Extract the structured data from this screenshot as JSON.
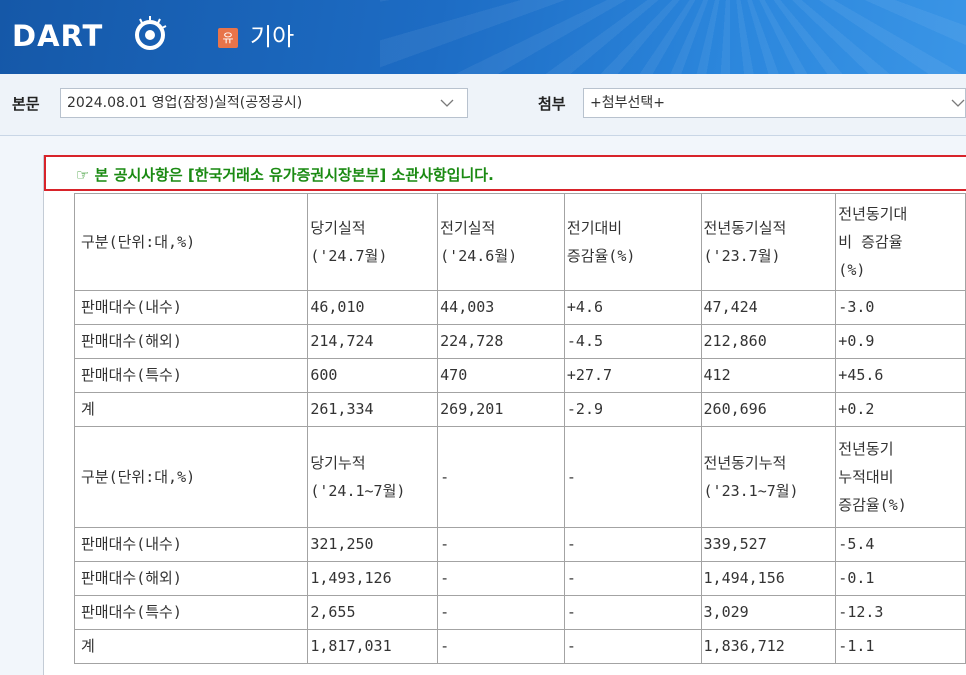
{
  "header": {
    "logo_text": "DART",
    "market_badge": "유",
    "company": "기아"
  },
  "subbar": {
    "body_label": "본문",
    "body_select": "2024.08.01  영업(잠정)실적(공정공시)",
    "attach_label": "첨부",
    "attach_select": "+첨부선택+"
  },
  "notice": "☞ 본 공시사항은 [한국거래소 유가증권시장본부] 소관사항입니다.",
  "table": {
    "monthly_header": {
      "c0": "구분(단위:대,%)",
      "c1": [
        "당기실적",
        "('24.7월)"
      ],
      "c2": [
        "전기실적",
        "('24.6월)"
      ],
      "c3": [
        "전기대비",
        "증감율(%)"
      ],
      "c4": [
        "전년동기실적",
        "('23.7월)"
      ],
      "c5": [
        "전년동기대",
        "비 증감율",
        "(%)"
      ]
    },
    "monthly_rows": [
      [
        "판매대수(내수)",
        "46,010",
        "44,003",
        "+4.6",
        "47,424",
        "-3.0"
      ],
      [
        "판매대수(해외)",
        "214,724",
        "224,728",
        "-4.5",
        "212,860",
        "+0.9"
      ],
      [
        "판매대수(특수)",
        "600",
        "470",
        "+27.7",
        "412",
        "+45.6"
      ],
      [
        "계",
        "261,334",
        "269,201",
        "-2.9",
        "260,696",
        "+0.2"
      ]
    ],
    "cumulative_header": {
      "c0": "구분(단위:대,%)",
      "c1": [
        "당기누적",
        "('24.1~7월)"
      ],
      "c2": "-",
      "c3": "-",
      "c4": [
        "전년동기누적",
        "('23.1~7월)"
      ],
      "c5": [
        "전년동기",
        "누적대비",
        "증감율(%)"
      ]
    },
    "cumulative_rows": [
      [
        "판매대수(내수)",
        "321,250",
        "-",
        "-",
        "339,527",
        "-5.4"
      ],
      [
        "판매대수(해외)",
        "1,493,126",
        "-",
        "-",
        "1,494,156",
        "-0.1"
      ],
      [
        "판매대수(특수)",
        "2,655",
        "-",
        "-",
        "3,029",
        "-12.3"
      ],
      [
        "계",
        "1,817,031",
        "-",
        "-",
        "1,836,712",
        "-1.1"
      ]
    ]
  },
  "colors": {
    "header_blue": "#1d6cc4",
    "notice_border": "#d8232a",
    "notice_text": "#1a8a12",
    "market_badge": "#e8744a"
  }
}
